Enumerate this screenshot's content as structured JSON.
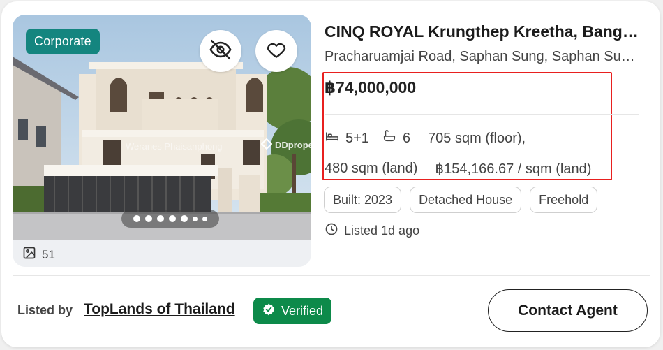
{
  "listing": {
    "badge": "Corporate",
    "title": "CINQ ROYAL Krungthep Kreetha, Bangkok",
    "address": "Pracharuamjai Road, Saphan Sung, Saphan Sung, Bangkok",
    "price": "฿74,000,000",
    "bedrooms": "5+1",
    "bathrooms": "6",
    "floor_area": "705 sqm (floor),",
    "land_area": "480 sqm (land)",
    "price_per_sqm": "฿154,166.67 / sqm (land)",
    "tags": [
      "Built: 2023",
      "Detached House",
      "Freehold"
    ],
    "listed_time": "Listed 1d ago",
    "photo_count": "51",
    "watermark": "Weranes Phaisanphong",
    "brand": "DDproper"
  },
  "carousel": {
    "total_dots": 7,
    "active_index": 0
  },
  "footer": {
    "listed_by_label": "Listed by",
    "agent_name": "TopLands of Thailand",
    "verified_label": "Verified",
    "contact_button": "Contact Agent"
  },
  "icons": {
    "hide": "eye-off-icon",
    "favorite": "heart-icon",
    "bed": "bed-icon",
    "bath": "bathtub-icon",
    "clock": "clock-icon",
    "photos": "image-icon",
    "verified": "verified-badge-icon"
  },
  "colors": {
    "corporate_badge": "#14857f",
    "verified_badge": "#0d8a4a",
    "highlight_box": "#e8201f"
  }
}
